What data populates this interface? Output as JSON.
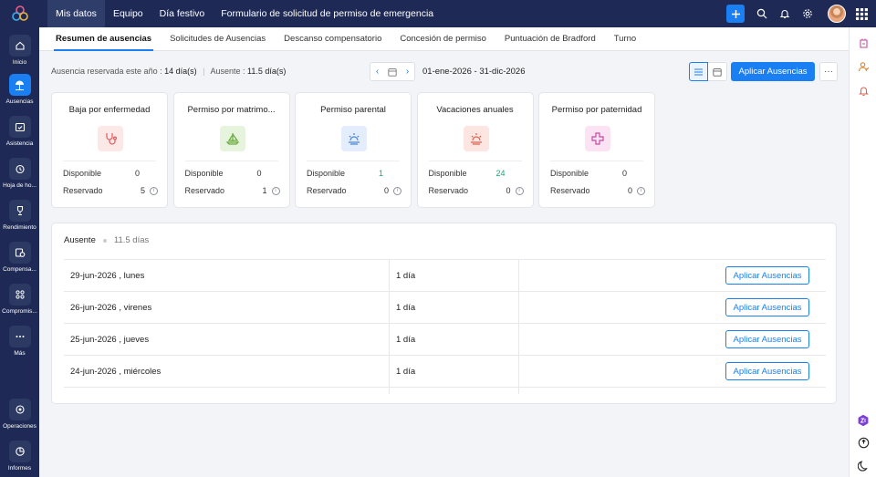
{
  "topnav": {
    "items": [
      "Mis datos",
      "Equipo",
      "Día festivo",
      "Formulario de solicitud de permiso de emergencia"
    ],
    "active_index": 0
  },
  "topbar_icons": [
    "plus-icon",
    "search-icon",
    "bell-icon",
    "settings-icon",
    "user-avatar",
    "apps-grid-icon"
  ],
  "sidebar": {
    "items": [
      {
        "label": "Inicio",
        "icon": "home-icon"
      },
      {
        "label": "Ausencias",
        "icon": "beach-umbrella-icon",
        "active": true
      },
      {
        "label": "Asistencia",
        "icon": "calendar-check-icon"
      },
      {
        "label": "Hoja de ho...",
        "icon": "timesheet-clock-icon"
      },
      {
        "label": "Rendimiento",
        "icon": "trophy-icon"
      },
      {
        "label": "Compensa...",
        "icon": "compensation-icon"
      },
      {
        "label": "Compromis...",
        "icon": "engagement-icon"
      },
      {
        "label": "Más",
        "icon": "more-dots-icon"
      },
      {
        "label": "Operaciones",
        "icon": "operations-icon"
      },
      {
        "label": "Informes",
        "icon": "pie-chart-icon"
      }
    ]
  },
  "subtabs": [
    "Resumen de ausencias",
    "Solicitudes de Ausencias",
    "Descanso compensatorio",
    "Concesión de permiso",
    "Puntuación de Bradford",
    "Turno"
  ],
  "summary": {
    "reserved_label": "Ausencia reservada este año :",
    "reserved_value": "14 día(s)",
    "absent_label": "Ausente :",
    "absent_value": "11.5 día(s)"
  },
  "date_range": "01-ene-2026 - 31-dic-2026",
  "apply_button": "Aplicar Ausencias",
  "more_button": "···",
  "cards": [
    {
      "title": "Baja por enfermedad",
      "icon": "stethoscope-icon",
      "bg": "#fde8e8",
      "color": "#e25b5b",
      "available_label": "Disponible",
      "available": "0",
      "reserved_label": "Reservado",
      "reserved": "5",
      "available_color": "#222222"
    },
    {
      "title": "Permiso por matrimo...",
      "icon": "sailboat-icon",
      "bg": "#e6f4dd",
      "color": "#6aaa3e",
      "available_label": "Disponible",
      "available": "0",
      "reserved_label": "Reservado",
      "reserved": "1",
      "available_color": "#222222"
    },
    {
      "title": "Permiso parental",
      "icon": "sunrise-icon",
      "bg": "#e3edfb",
      "color": "#4a86d8",
      "available_label": "Disponible",
      "available": "1",
      "reserved_label": "Reservado",
      "reserved": "0",
      "available_color": "#19a57a"
    },
    {
      "title": "Vacaciones anuales",
      "icon": "sunset-icon",
      "bg": "#fde5e2",
      "color": "#e0604e",
      "available_label": "Disponible",
      "available": "24",
      "reserved_label": "Reservado",
      "reserved": "0",
      "available_color": "#19a57a"
    },
    {
      "title": "Permiso por paternidad",
      "icon": "medical-cross-icon",
      "bg": "#fbe3f3",
      "color": "#c94aa2",
      "available_label": "Disponible",
      "available": "0",
      "reserved_label": "Reservado",
      "reserved": "0",
      "available_color": "#222222"
    }
  ],
  "absent_section": {
    "title": "Ausente",
    "days": "11.5 días",
    "rows": [
      {
        "date": "29-jun-2026 , lunes",
        "duration": "1 día",
        "action": "Aplicar Ausencias"
      },
      {
        "date": "26-jun-2026 , virenes",
        "duration": "1 día",
        "action": "Aplicar Ausencias"
      },
      {
        "date": "25-jun-2026 , jueves",
        "duration": "1 día",
        "action": "Aplicar Ausencias"
      },
      {
        "date": "24-jun-2026 , miércoles",
        "duration": "1 día",
        "action": "Aplicar Ausencias"
      }
    ]
  },
  "rightbar_icons": [
    "leave-request-icon",
    "user-check-icon",
    "bell-alert-icon",
    "zia-badge-icon",
    "help-icon",
    "dark-mode-icon"
  ],
  "colors": {
    "topbar": "#1e2a55",
    "accent": "#1a7ff3",
    "positive": "#19a57a"
  }
}
